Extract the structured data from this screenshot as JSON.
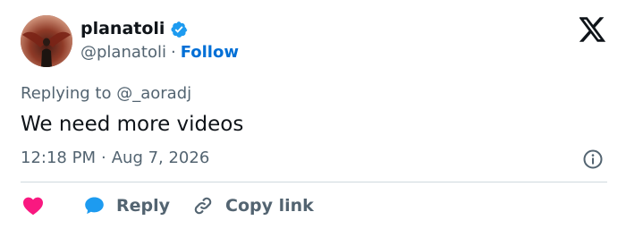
{
  "tweet": {
    "author": {
      "display_name": "planatoli",
      "handle": "@planatoli",
      "follow_label": "Follow",
      "verified": true
    },
    "separator": "·",
    "replying_prefix": "Replying to",
    "replying_to": "@_aoradj",
    "text": "We need more videos",
    "time": "12:18 PM",
    "date": "Aug 7, 2026"
  },
  "actions": {
    "reply_label": "Reply",
    "copy_link_label": "Copy link"
  },
  "icons": {
    "brand": "x-logo-icon",
    "verified": "verified-badge-icon",
    "info": "info-icon",
    "like": "heart-icon",
    "reply": "reply-bubble-icon",
    "copy": "link-icon"
  },
  "colors": {
    "accent": "#1d9bf0",
    "follow": "#006fd6",
    "like": "#f91880",
    "muted": "#536471",
    "text": "#0f1419",
    "divider": "#cfd9de"
  }
}
